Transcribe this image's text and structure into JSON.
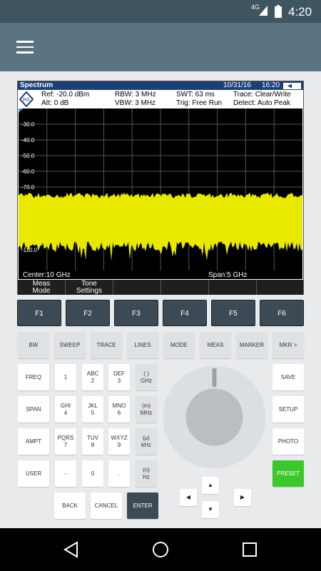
{
  "status_bar": {
    "network": "4G",
    "time": "4:20"
  },
  "instrument": {
    "title": "Spectrum",
    "date": "10/31/16",
    "time": "16:20",
    "ref": "Ref: -20.0 dBm",
    "att": "Att: 0 dB",
    "rbw": "RBW:  3 MHz",
    "vbw": "VBW:  3 MHz",
    "swt": "SWT:  63 ms",
    "trig": "Trig:  Free Run",
    "trace": "Trace:  Clear/Write",
    "detect": "Detect:  Auto Peak",
    "center": "Center:10 GHz",
    "span": "Span:5 GHz",
    "y_ticks": [
      "-30.0",
      "-40.0",
      "-50.0",
      "-60.0",
      "-70.0",
      "-110.0"
    ],
    "softkeys": [
      {
        "l1": "Meas",
        "l2": "Mode"
      },
      {
        "l1": "Tone",
        "l2": "Settings"
      },
      {
        "l1": "",
        "l2": ""
      },
      {
        "l1": "",
        "l2": ""
      },
      {
        "l1": "",
        "l2": ""
      },
      {
        "l1": "",
        "l2": ""
      }
    ]
  },
  "function_keys": [
    "F1",
    "F2",
    "F3",
    "F4",
    "F5",
    "F6"
  ],
  "top_row": [
    "BW",
    "SWEEP",
    "TRACE",
    "LINES",
    "MODE",
    "MEAS",
    "MARKER",
    "MKR >"
  ],
  "left_col": [
    "FREQ",
    "SPAN",
    "AMPT",
    "USER"
  ],
  "numpad": [
    [
      {
        "t": "",
        "b": "1"
      },
      {
        "t": "ABC",
        "b": "2"
      },
      {
        "t": "DEF",
        "b": "3"
      },
      {
        "t": "( )",
        "b": "GHz"
      }
    ],
    [
      {
        "t": "GHI",
        "b": "4"
      },
      {
        "t": "JKL",
        "b": "5"
      },
      {
        "t": "MNO",
        "b": "6"
      },
      {
        "t": "(m)",
        "b": "MHz"
      }
    ],
    [
      {
        "t": "PQRS",
        "b": "7"
      },
      {
        "t": "TUV",
        "b": "8"
      },
      {
        "t": "WXYZ",
        "b": "9"
      },
      {
        "t": "(μ)",
        "b": "kHz"
      }
    ],
    [
      {
        "t": "",
        "b": "-"
      },
      {
        "t": "",
        "b": "0"
      },
      {
        "t": "",
        "b": "."
      },
      {
        "t": "(n)",
        "b": "Hz"
      }
    ]
  ],
  "bottom_row": [
    "BACK",
    "CANCEL",
    "ENTER"
  ],
  "right_col": [
    "SAVE",
    "SETUP",
    "PHOTO",
    "PRESET"
  ],
  "colors": {
    "trace": "#e8e800",
    "preset": "#3cc82a",
    "header": "#1d3f78"
  },
  "icons": {
    "menu": "hamburger-icon",
    "back": "back-triangle-icon",
    "home": "home-circle-icon",
    "recents": "recents-square-icon"
  }
}
